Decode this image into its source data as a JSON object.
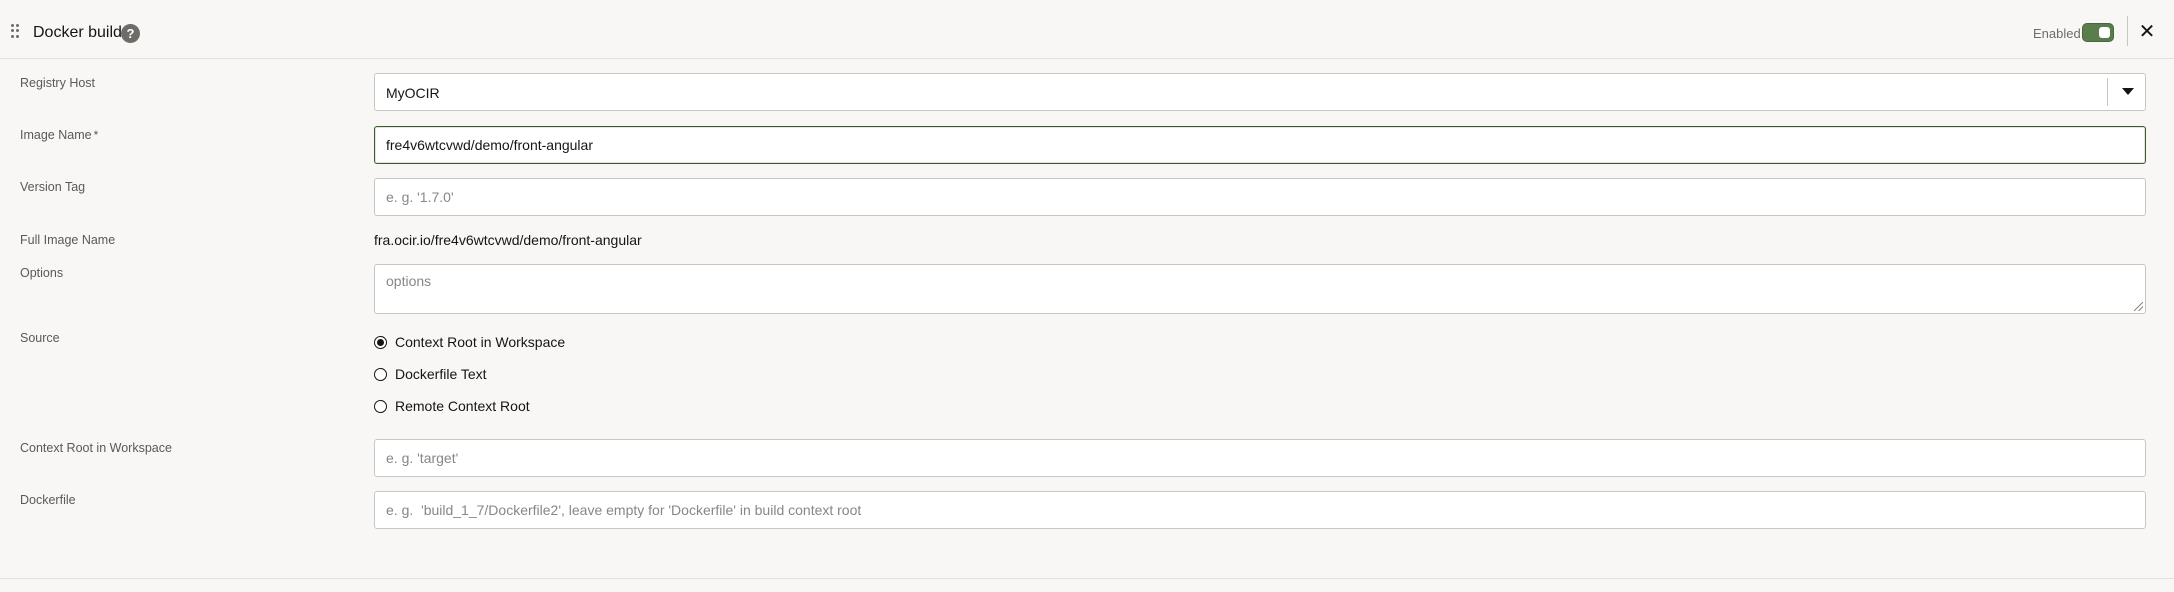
{
  "header": {
    "title": "Docker build",
    "help_icon": "?",
    "enabled_label": "Enabled",
    "enabled": true,
    "close_icon": "✕"
  },
  "form": {
    "registry_host": {
      "label": "Registry Host",
      "value": "MyOCIR"
    },
    "image_name": {
      "label": "Image Name",
      "required_mark": "*",
      "value": "fre4v6wtcvwd/demo/front-angular"
    },
    "version_tag": {
      "label": "Version Tag",
      "placeholder": "e. g. '1.7.0'"
    },
    "full_image_name": {
      "label": "Full Image Name",
      "value": "fra.ocir.io/fre4v6wtcvwd/demo/front-angular"
    },
    "options": {
      "label": "Options",
      "placeholder": "options"
    },
    "source": {
      "label": "Source",
      "options": [
        "Context Root in Workspace",
        "Dockerfile Text",
        "Remote Context Root"
      ],
      "selected": "Context Root in Workspace"
    },
    "context_root": {
      "label": "Context Root in Workspace",
      "placeholder": "e. g. 'target'"
    },
    "dockerfile": {
      "label": "Dockerfile",
      "placeholder": "e. g.  'build_1_7/Dockerfile2', leave empty for 'Dockerfile' in build context root"
    }
  },
  "colors": {
    "background": "#f8f7f5",
    "toggle_on": "#5a7d4e",
    "focus_border": "#3b5a2f"
  }
}
